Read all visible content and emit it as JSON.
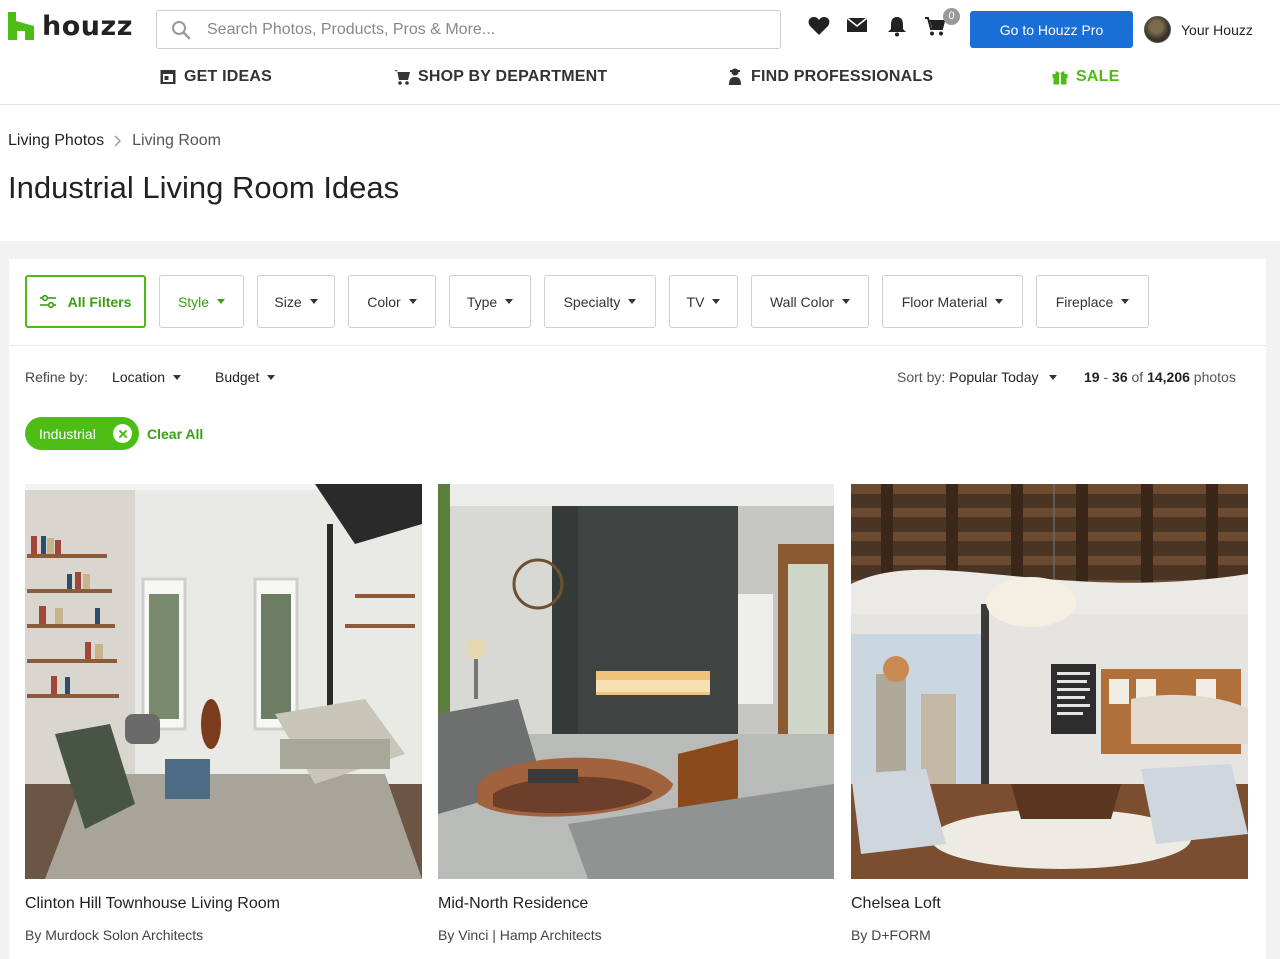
{
  "brand": {
    "name": "houzz",
    "color": "#4dbc15"
  },
  "search": {
    "placeholder": "Search Photos, Products, Pros & More..."
  },
  "header": {
    "icons": [
      "heart-icon",
      "mail-icon",
      "bell-icon",
      "cart-icon"
    ],
    "cart_count": "0",
    "pro_button": "Go to Houzz Pro",
    "user_label": "Your Houzz"
  },
  "nav": {
    "get_ideas": "GET IDEAS",
    "shop": "SHOP BY DEPARTMENT",
    "find_pros": "FIND PROFESSIONALS",
    "sale": "SALE"
  },
  "breadcrumb": {
    "parent": "Living Photos",
    "current": "Living Room"
  },
  "page_title": "Industrial Living Room Ideas",
  "filters": {
    "all": "All Filters",
    "items": [
      "Style",
      "Size",
      "Color",
      "Type",
      "Specialty",
      "TV",
      "Wall Color",
      "Floor Material",
      "Fireplace"
    ]
  },
  "refine": {
    "label": "Refine by:",
    "location": "Location",
    "budget": "Budget"
  },
  "sort": {
    "label": "Sort by:",
    "value": "Popular Today"
  },
  "results": {
    "range_start": "19",
    "range_end": "36",
    "of": "of",
    "total": "14,206",
    "unit": "photos",
    "dash": "-"
  },
  "active_filter": {
    "label": "Industrial",
    "clear": "Clear All"
  },
  "cards": [
    {
      "title": "Clinton Hill Townhouse Living Room",
      "by": "By Murdock Solon Architects"
    },
    {
      "title": "Mid-North Residence",
      "by": "By Vinci | Hamp Architects"
    },
    {
      "title": "Chelsea Loft",
      "by": "By D+FORM"
    }
  ]
}
